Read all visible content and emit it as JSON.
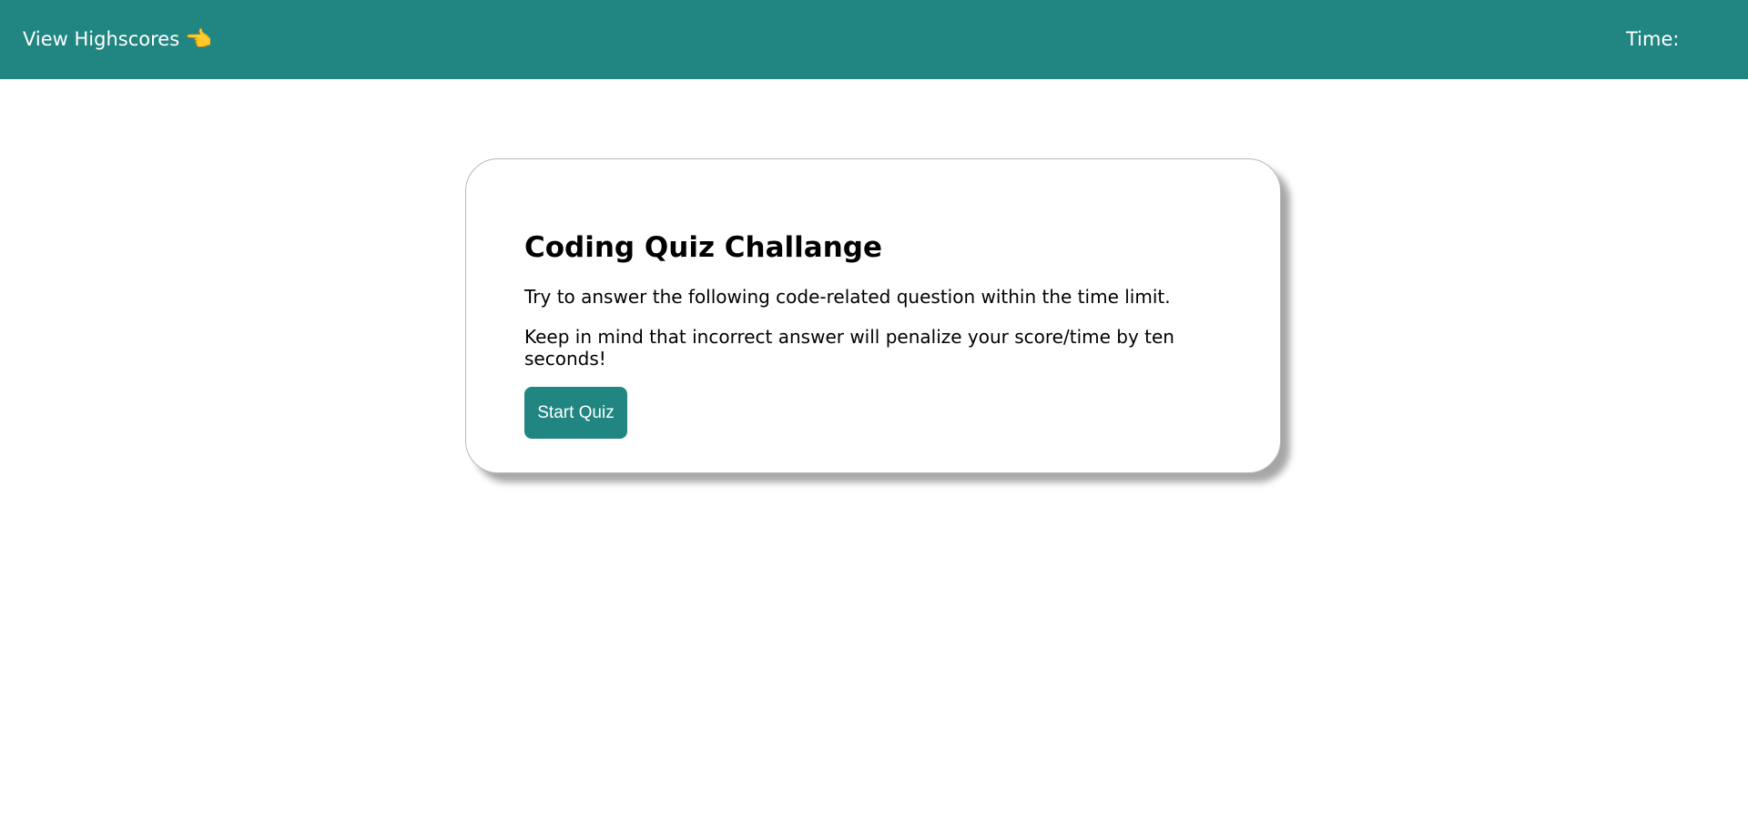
{
  "header": {
    "highscores_label": "View Highscores",
    "highscores_icon": "pointing-hand-icon",
    "hand_glyph": "👈",
    "timer_label": "Time:",
    "timer_value": ""
  },
  "intro": {
    "title": "Coding Quiz Challange",
    "paragraph_1": "Try to answer the following code-related question within the time limit.",
    "paragraph_2": "Keep in mind that incorrect answer will penalize your score/time by ten seconds!",
    "start_label": "Start Quiz"
  },
  "colors": {
    "accent": "#218581",
    "background": "#ffffff"
  }
}
